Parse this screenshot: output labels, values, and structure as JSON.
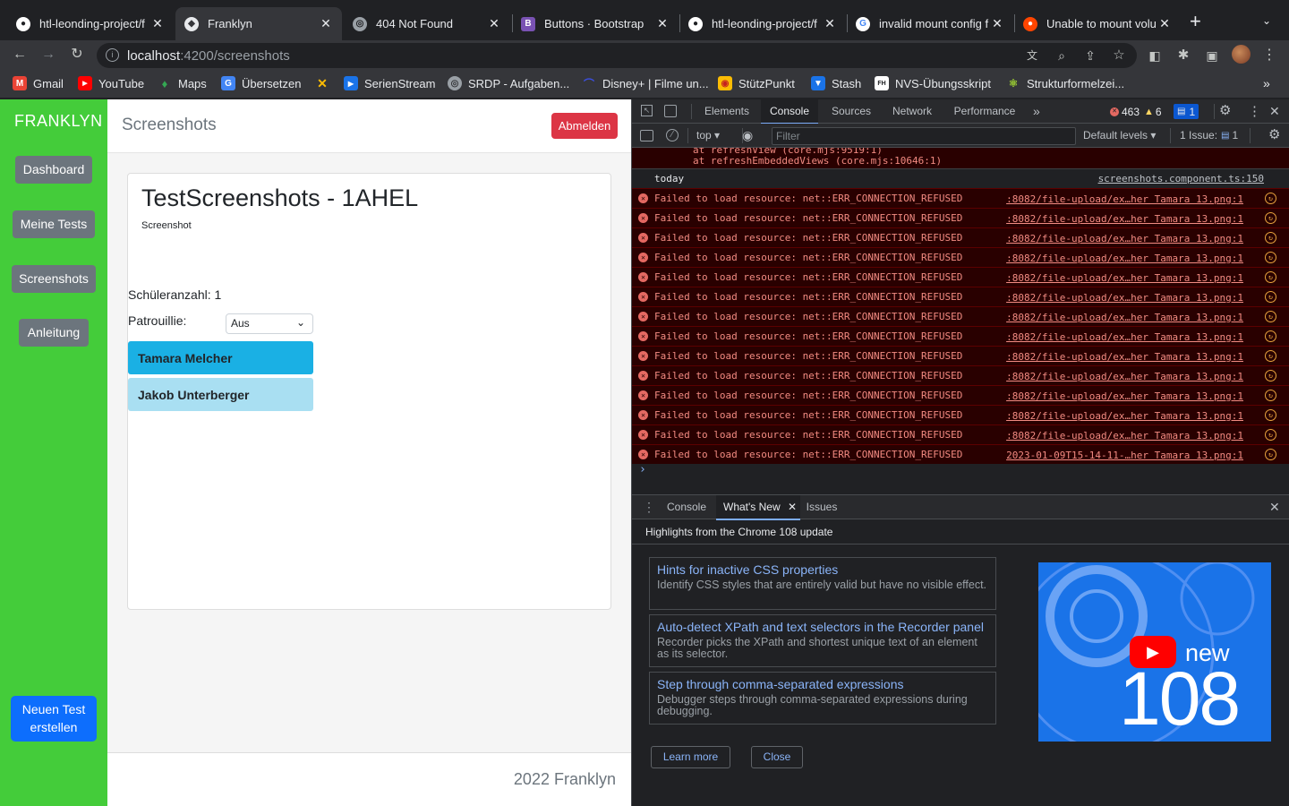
{
  "browser": {
    "tabs": [
      {
        "title": "htl-leonding-project/f",
        "favicon": "github-icon"
      },
      {
        "title": "Franklyn",
        "favicon": "app-icon",
        "active": true
      },
      {
        "title": "404 Not Found",
        "favicon": "globe-icon"
      },
      {
        "title": "Buttons · Bootstrap",
        "favicon": "bootstrap-icon"
      },
      {
        "title": "htl-leonding-project/f",
        "favicon": "github-icon"
      },
      {
        "title": "invalid mount config f",
        "favicon": "google-icon"
      },
      {
        "title": "Unable to mount volu",
        "favicon": "reddit-icon"
      }
    ],
    "url_host": "localhost",
    "url_path": ":4200/screenshots",
    "bookmarks": [
      "Gmail",
      "YouTube",
      "Maps",
      "Übersetzen",
      "SerienStream",
      "SRDP - Aufgaben...",
      "Disney+ | Filme un...",
      "StützPunkt",
      "Stash",
      "NVS-Übungsskript",
      "Strukturformelzei..."
    ]
  },
  "app": {
    "brand": "FRANKLYN",
    "nav": [
      "Dashboard",
      "Meine Tests",
      "Screenshots",
      "Anleitung"
    ],
    "new_test_line1": "Neuen Test",
    "new_test_line2": "erstellen",
    "page_title": "Screenshots",
    "logout": "Abmelden",
    "card_title": "TestScreenshots - 1AHEL",
    "image_alt": "Screenshot",
    "pupil_count": "Schüleranzahl: 1",
    "patrol_label": "Patrouillie:",
    "patrol_value": "Aus",
    "students": [
      "Tamara Melcher",
      "Jakob Unterberger"
    ],
    "footer": "2022 Franklyn"
  },
  "devtools": {
    "tabs": [
      "Elements",
      "Console",
      "Sources",
      "Network",
      "Performance"
    ],
    "error_count": "463",
    "warning_count": "6",
    "info_count": "1",
    "context": "top",
    "filter_placeholder": "Filter",
    "levels": "Default levels",
    "issues": "1 Issue:",
    "issues_count": "1",
    "trace_line1": "at refreshView (core.mjs:9519:1)",
    "trace_line2": "at refreshEmbeddedViews (core.mjs:10646:1)",
    "log_today": "today",
    "log_today_src": "screenshots.component.ts:150",
    "error_message": "Failed to load resource: net::ERR_CONNECTION_REFUSED",
    "error_src": ":8082/file-upload/ex…her Tamara 13.png:1",
    "error_src_last": "2023-01-09T15-14-11-…her Tamara 13.png:1",
    "drawer_tabs": [
      "Console",
      "What's New",
      "Issues"
    ],
    "highlights": "Highlights from the Chrome 108 update",
    "features": [
      {
        "title": "Hints for inactive CSS properties",
        "desc": "Identify CSS styles that are entirely valid but have no visible effect."
      },
      {
        "title": "Auto-detect XPath and text selectors in the Recorder panel",
        "desc": "Recorder picks the XPath and shortest unique text of an element as its selector."
      },
      {
        "title": "Step through comma-separated expressions",
        "desc": "Debugger steps through comma-separated expressions during debugging."
      }
    ],
    "promo_new": "new",
    "promo_version": "108",
    "learn_more": "Learn more",
    "close": "Close"
  }
}
